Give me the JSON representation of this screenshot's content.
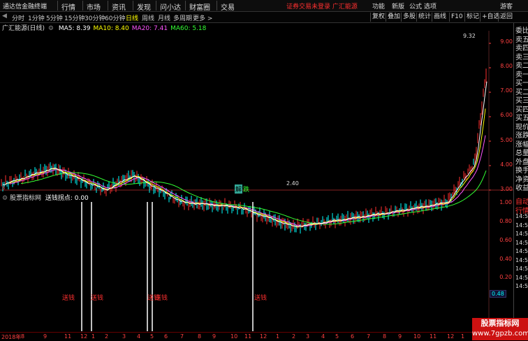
{
  "app": {
    "title": "通达信金融终端"
  },
  "menu": [
    "行情",
    "市场",
    "资讯",
    "发现",
    "问小达",
    "财富圈",
    "交易"
  ],
  "login_text": "证券交易未登录  广汇能源",
  "sys_menu": [
    "功能",
    "新版",
    "公式",
    "选项",
    "游客"
  ],
  "periods": [
    "分时",
    "1分钟",
    "5分钟",
    "15分钟",
    "30分钟",
    "60分钟",
    "日线",
    "周线",
    "月线",
    "多周期",
    "更多 >"
  ],
  "active_period": "日线",
  "right_tools": [
    "复权",
    "叠加",
    "多股",
    "统计",
    "画线",
    "F10",
    "标记",
    "+自选",
    "返回"
  ],
  "stock": {
    "name": "广汇能源(日线)"
  },
  "ma": [
    {
      "label": "MA5: 8.39",
      "color": "#ffffff"
    },
    {
      "label": "MA10: 8.40",
      "color": "#ffff00"
    },
    {
      "label": "MA20: 7.41",
      "color": "#ff55ff"
    },
    {
      "label": "MA60: 5.18",
      "color": "#33ff33"
    }
  ],
  "price_axis": [
    "9.00",
    "8.00",
    "7.00",
    "6.00",
    "5.00",
    "4.00",
    "3.00"
  ],
  "max_label": "9.32",
  "min_label": "2.40",
  "badges": [
    "解",
    "跌"
  ],
  "indicator": {
    "name": "股票指标网",
    "line": "送钱拐点: 0.00"
  },
  "ind_axis": [
    "1.00",
    "0.80",
    "0.60",
    "0.40",
    "0.20"
  ],
  "ind_current": "0.48",
  "signals": [
    "送钱",
    "送钱",
    "送钱",
    "送钱",
    "送钱"
  ],
  "right_panel": [
    "委比",
    "卖五",
    "卖四",
    "卖三",
    "卖二",
    "卖一",
    "买一",
    "买二",
    "买三",
    "买四",
    "买五",
    "现价",
    "涨跌",
    "涨幅",
    "总量",
    "外盘",
    "换手",
    "净资",
    "收益"
  ],
  "right_panel2": [
    "自动",
    "行情",
    "14:50",
    "14:50",
    "14:50",
    "14:50",
    "14:50",
    "14:50",
    "14:50",
    "14:50",
    "14:50"
  ],
  "dates": [
    "2018年",
    "8",
    "9",
    "11",
    "12",
    "1",
    "2",
    "3",
    "4",
    "5",
    "6",
    "7",
    "8",
    "9",
    "10",
    "11",
    "12",
    "1",
    "2",
    "3",
    "4",
    "5",
    "6",
    "7",
    "8",
    "9",
    "10",
    "11",
    "12",
    "1",
    "2",
    "3"
  ],
  "watermark": {
    "line1": "股票指标网",
    "line2": "www.7gpzb.com"
  },
  "colors": {
    "up": "#ff3030",
    "down": "#00ffff",
    "axis": "#ff4040"
  }
}
